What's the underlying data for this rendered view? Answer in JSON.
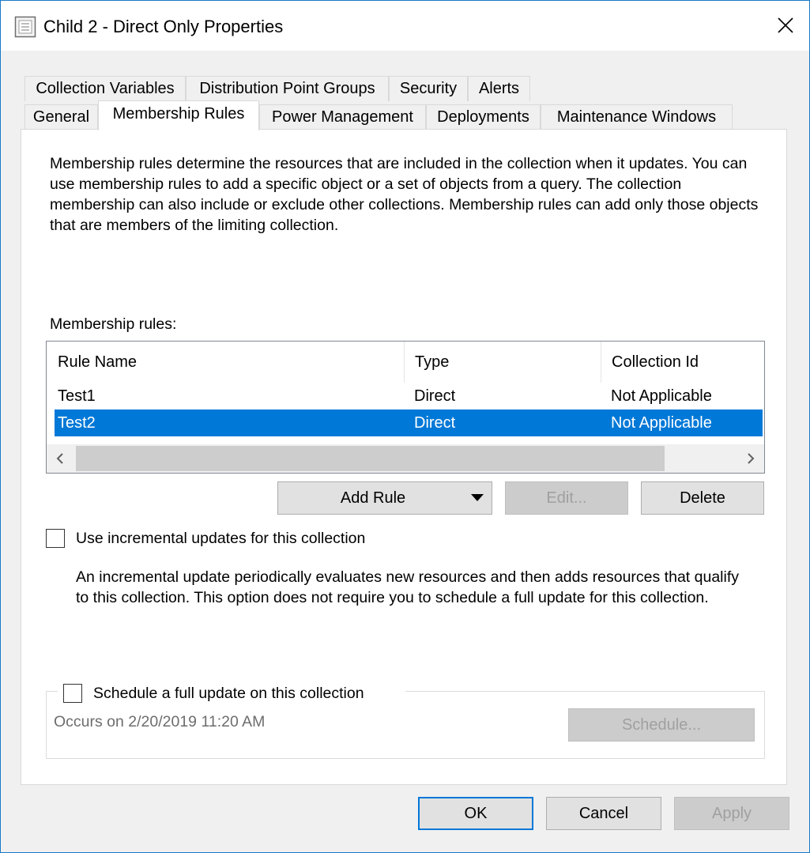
{
  "window": {
    "title": "Child 2 - Direct Only Properties"
  },
  "tabs": {
    "row1": [
      "Collection Variables",
      "Distribution Point Groups",
      "Security",
      "Alerts"
    ],
    "row2": [
      "General",
      "Membership Rules",
      "Power Management",
      "Deployments",
      "Maintenance Windows"
    ],
    "active": "Membership Rules"
  },
  "description": "Membership rules determine the resources that are included in the collection when it updates. You can use membership rules to add a specific object or a set of objects from a query. The collection membership can also include or exclude other collections. Membership rules can add only those objects that are members of the limiting collection.",
  "rules": {
    "label": "Membership rules:",
    "columns": [
      "Rule Name",
      "Type",
      "Collection Id"
    ],
    "rows": [
      {
        "name": "Test1",
        "type": "Direct",
        "collection_id": "Not Applicable",
        "selected": false
      },
      {
        "name": "Test2",
        "type": "Direct",
        "collection_id": "Not Applicable",
        "selected": true
      }
    ],
    "buttons": {
      "add": "Add Rule",
      "edit": "Edit...",
      "delete": "Delete"
    }
  },
  "incremental": {
    "label": "Use incremental updates for this collection",
    "checked": false,
    "help": "An incremental update periodically evaluates new resources and then adds resources that qualify to this collection. This option does not require you to schedule a full update for this collection."
  },
  "schedule": {
    "label": "Schedule a full update on this collection",
    "checked": false,
    "occurs": "Occurs on 2/20/2019 11:20 AM",
    "button": "Schedule..."
  },
  "footer": {
    "ok": "OK",
    "cancel": "Cancel",
    "apply": "Apply"
  },
  "colors": {
    "accent": "#0078d7",
    "selection": "#0078d7",
    "disabled_text": "#a0a0a0"
  }
}
